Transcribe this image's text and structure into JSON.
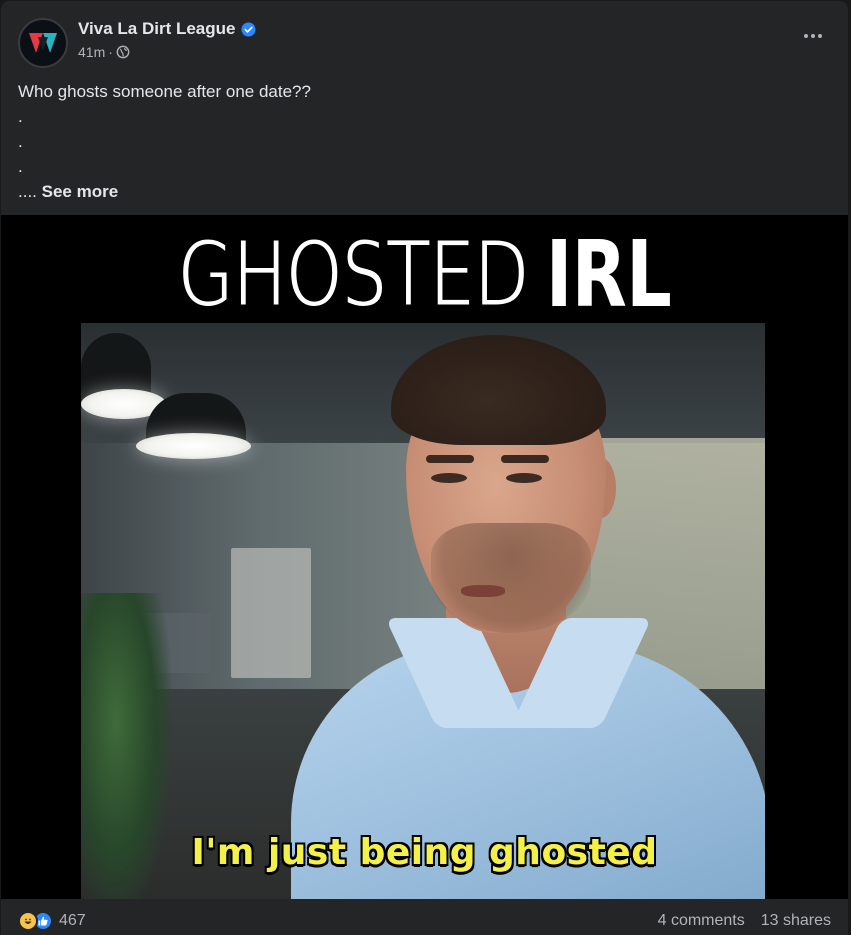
{
  "post": {
    "author": "Viva La Dirt League",
    "verified": true,
    "time": "41m",
    "separator": "·",
    "audience_icon": "globe-icon",
    "more_icon": "more-horizontal-icon",
    "text_lines": [
      "Who ghosts someone after one date??",
      ".",
      ".",
      "."
    ],
    "see_more_prefix": "....",
    "see_more_label": "See more"
  },
  "media": {
    "title_part1": "GHOSTED",
    "title_part2": "IRL",
    "subtitle": "I'm just being ghosted"
  },
  "footer": {
    "reaction_icons": [
      "haha-icon",
      "like-icon"
    ],
    "reaction_count": "467",
    "comments": "4 comments",
    "shares": "13 shares"
  },
  "colors": {
    "background": "#242526",
    "text": "#e4e6eb",
    "secondary_text": "#b0b3b8",
    "verified_blue": "#2d88ff",
    "subtitle_yellow": "#f4f04a"
  }
}
